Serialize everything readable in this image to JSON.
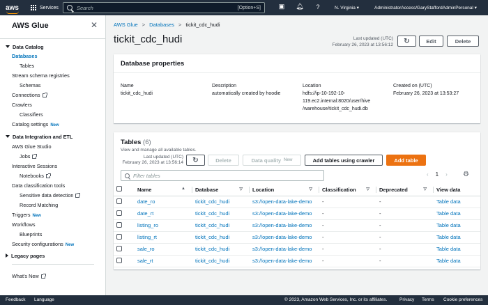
{
  "topnav": {
    "logo": "aws",
    "services_label": "Services",
    "search_placeholder": "Search",
    "search_shortcut": "[Option+S]",
    "region": "N. Virginia",
    "account": "AdministratorAccess/GaryStaffordAdminPersonal"
  },
  "sidebar": {
    "title": "AWS Glue",
    "data_catalog": "Data Catalog",
    "databases": "Databases",
    "tables": "Tables",
    "stream_schema": "Stream schema registries",
    "schemas": "Schemas",
    "connections": "Connections",
    "crawlers": "Crawlers",
    "classifiers": "Classifiers",
    "catalog_settings": "Catalog settings",
    "new": "New",
    "data_integration": "Data Integration and ETL",
    "glue_studio": "AWS Glue Studio",
    "jobs": "Jobs",
    "interactive_sessions": "Interactive Sessions",
    "notebooks": "Notebooks",
    "data_classification": "Data classification tools",
    "sensitive": "Sensitive data detection",
    "record_matching": "Record Matching",
    "triggers": "Triggers",
    "workflows": "Workflows",
    "blueprints": "Blueprints",
    "security_configs": "Security configurations",
    "legacy_pages": "Legacy pages",
    "whats_new": "What's New"
  },
  "breadcrumb": {
    "root": "AWS Glue",
    "databases": "Databases",
    "current": "tickit_cdc_hudi"
  },
  "header": {
    "title": "tickit_cdc_hudi",
    "last_updated_label": "Last updated (UTC)",
    "last_updated_value": "February 26, 2023 at 13:56:12",
    "edit": "Edit",
    "delete": "Delete"
  },
  "properties": {
    "title": "Database properties",
    "name_label": "Name",
    "name_value": "tickit_cdc_hudi",
    "desc_label": "Description",
    "desc_value": "automatically created by hoodie",
    "loc_label": "Location",
    "loc_line1": "hdfs://ip-10-192-10-",
    "loc_line2": "119.ec2.internal:8020/user/hive",
    "loc_line3": "/warehouse/tickit_cdc_hudi.db",
    "created_label": "Created on (UTC)",
    "created_value": "February 26, 2023 at 13:53:27"
  },
  "tables_section": {
    "title": "Tables",
    "count": "(6)",
    "description": "View and manage all available tables.",
    "last_updated_label": "Last updated (UTC)",
    "last_updated_value": "February 26, 2023 at 13:56:14",
    "delete": "Delete",
    "data_quality": "Data quality",
    "data_quality_tag": "New",
    "add_crawler": "Add tables using crawler",
    "add_table": "Add table",
    "filter_placeholder": "Filter tables",
    "page": "1",
    "columns": [
      "Name",
      "Database",
      "Location",
      "Classification",
      "Deprecated",
      "View data"
    ],
    "rows": [
      {
        "name": "date_ro",
        "database": "tickit_cdc_hudi",
        "location": "s3://open-data-lake-demo",
        "classification": "-",
        "deprecated": "-",
        "view": "Table data"
      },
      {
        "name": "date_rt",
        "database": "tickit_cdc_hudi",
        "location": "s3://open-data-lake-demo",
        "classification": "-",
        "deprecated": "-",
        "view": "Table data"
      },
      {
        "name": "listing_ro",
        "database": "tickit_cdc_hudi",
        "location": "s3://open-data-lake-demo",
        "classification": "-",
        "deprecated": "-",
        "view": "Table data"
      },
      {
        "name": "listing_rt",
        "database": "tickit_cdc_hudi",
        "location": "s3://open-data-lake-demo",
        "classification": "-",
        "deprecated": "-",
        "view": "Table data"
      },
      {
        "name": "sale_ro",
        "database": "tickit_cdc_hudi",
        "location": "s3://open-data-lake-demo",
        "classification": "-",
        "deprecated": "-",
        "view": "Table data"
      },
      {
        "name": "sale_rt",
        "database": "tickit_cdc_hudi",
        "location": "s3://open-data-lake-demo",
        "classification": "-",
        "deprecated": "-",
        "view": "Table data"
      }
    ]
  },
  "footer": {
    "feedback": "Feedback",
    "language": "Language",
    "copyright": "© 2023, Amazon Web Services, Inc. or its affiliates.",
    "privacy": "Privacy",
    "terms": "Terms",
    "cookies": "Cookie preferences"
  }
}
